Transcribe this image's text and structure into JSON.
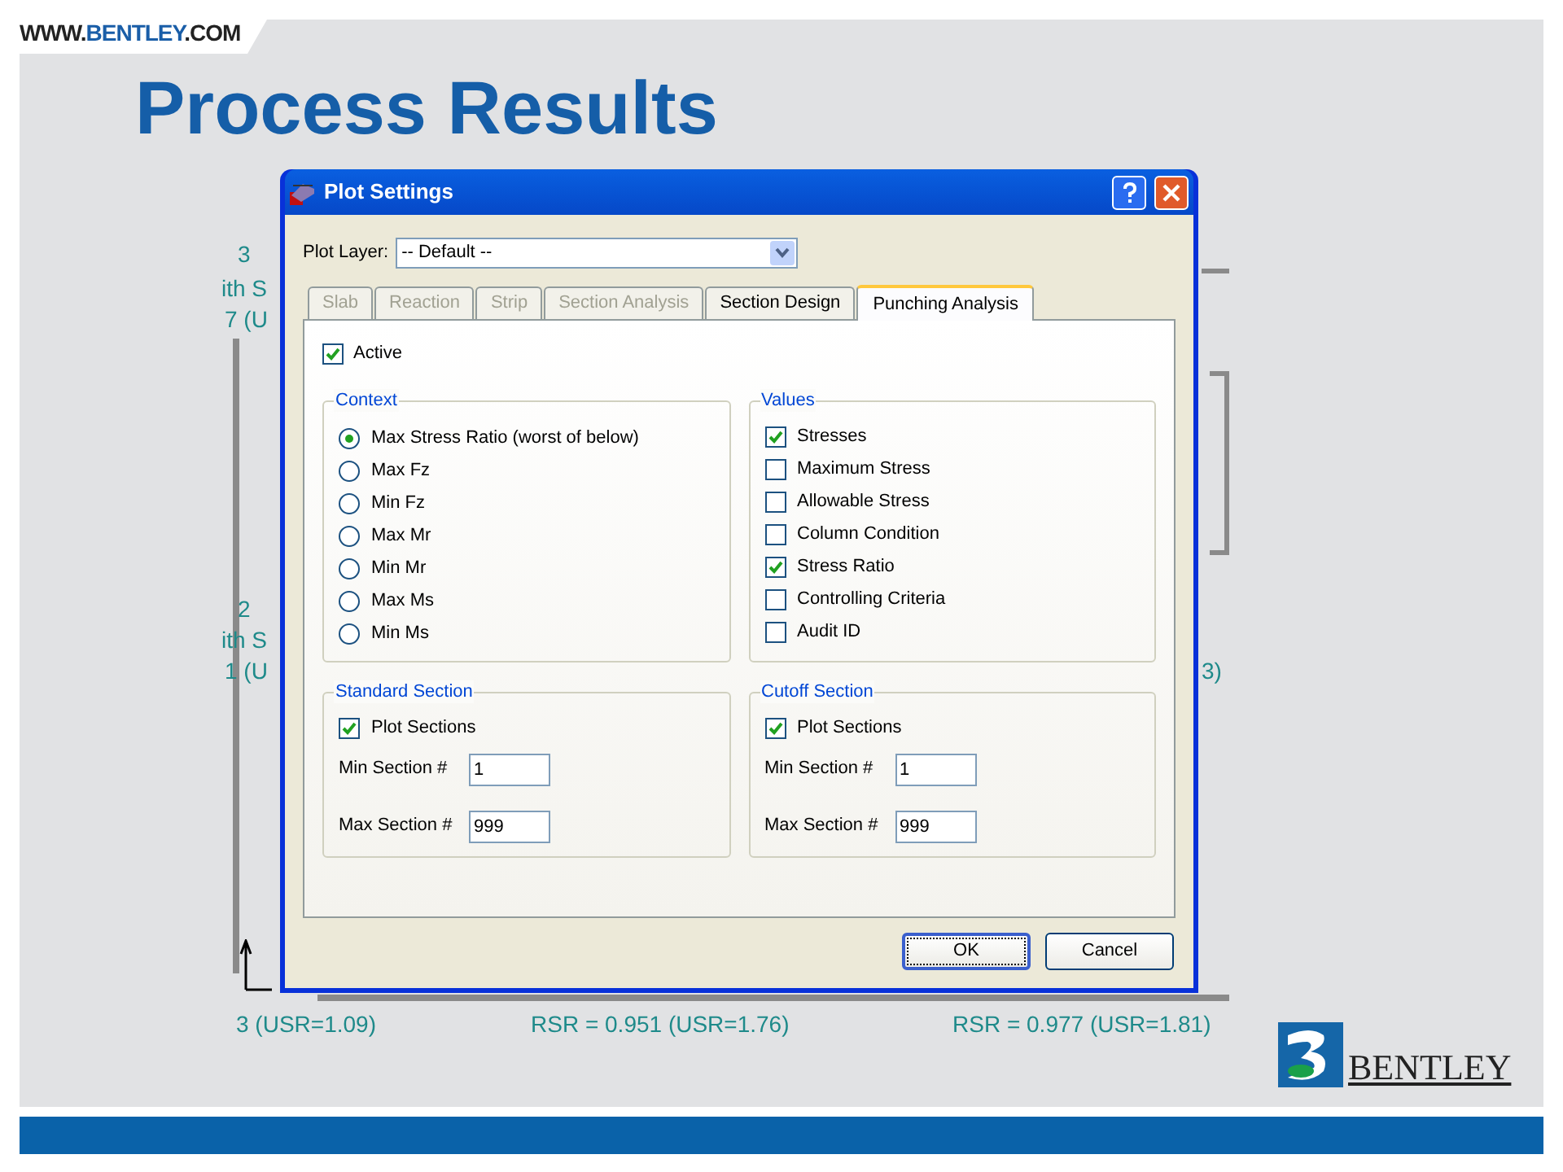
{
  "header": {
    "prefix": "WWW.",
    "brand": "BENTLEY",
    "suffix": ".COM"
  },
  "title": "Process Results",
  "drawing_labels": [
    "3",
    "ith S",
    "7 (U",
    "2",
    "ith S",
    "1 (U",
    "3)",
    "3 (USR=1.09)",
    "RSR = 0.951 (USR=1.76)",
    "RSR = 0.977 (USR=1.81)"
  ],
  "dialog": {
    "title": "Plot Settings",
    "plot_layer": {
      "label": "Plot Layer:",
      "value": "-- Default --"
    },
    "tabs": [
      {
        "label": "Slab",
        "selected": false,
        "disabled": true
      },
      {
        "label": "Reaction",
        "selected": false,
        "disabled": true
      },
      {
        "label": "Strip",
        "selected": false,
        "disabled": true
      },
      {
        "label": "Section Analysis",
        "selected": false,
        "disabled": true
      },
      {
        "label": "Section Design",
        "selected": false,
        "disabled": false
      },
      {
        "label": "Punching Analysis",
        "selected": true,
        "disabled": false
      }
    ],
    "active": {
      "label": "Active",
      "checked": true
    },
    "context": {
      "title": "Context",
      "options": [
        {
          "label": "Max Stress Ratio (worst of below)",
          "selected": true
        },
        {
          "label": "Max Fz",
          "selected": false
        },
        {
          "label": "Min Fz",
          "selected": false
        },
        {
          "label": "Max Mr",
          "selected": false
        },
        {
          "label": "Min Mr",
          "selected": false
        },
        {
          "label": "Max Ms",
          "selected": false
        },
        {
          "label": "Min Ms",
          "selected": false
        }
      ]
    },
    "values": {
      "title": "Values",
      "items": [
        {
          "label": "Stresses",
          "checked": true
        },
        {
          "label": "Maximum Stress",
          "checked": false
        },
        {
          "label": "Allowable Stress",
          "checked": false
        },
        {
          "label": "Column Condition",
          "checked": false
        },
        {
          "label": "Stress Ratio",
          "checked": true
        },
        {
          "label": "Controlling Criteria",
          "checked": false
        },
        {
          "label": "Audit ID",
          "checked": false
        }
      ]
    },
    "sections": [
      {
        "title": "Standard Section",
        "plot": {
          "label": "Plot Sections",
          "checked": true
        },
        "min": {
          "label": "Min Section #",
          "value": "1"
        },
        "max": {
          "label": "Max Section #",
          "value": "999"
        }
      },
      {
        "title": "Cutoff Section",
        "plot": {
          "label": "Plot Sections",
          "checked": true
        },
        "min": {
          "label": "Min Section #",
          "value": "1"
        },
        "max": {
          "label": "Max Section #",
          "value": "999"
        }
      }
    ],
    "buttons": [
      {
        "label": "OK",
        "default": true
      },
      {
        "label": "Cancel",
        "default": false
      }
    ]
  },
  "logo": {
    "text": "BENTLEY"
  }
}
